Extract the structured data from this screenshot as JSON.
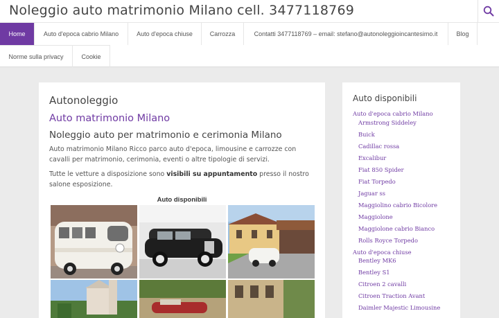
{
  "header": {
    "site_title": "Noleggio auto matrimonio Milano cell. 3477118769",
    "search_icon": "search-icon"
  },
  "nav": {
    "items": [
      {
        "label": "Home",
        "active": true
      },
      {
        "label": "Auto d'epoca cabrio Milano"
      },
      {
        "label": "Auto d'epoca chiuse"
      },
      {
        "label": "Carrozza"
      },
      {
        "label": "Contatti 3477118769 – email: stefano@autonoleggioincantesimo.it"
      },
      {
        "label": "Blog"
      },
      {
        "label": "Norme sulla privacy"
      },
      {
        "label": "Cookie"
      }
    ]
  },
  "main": {
    "page_title": "Autonoleggio",
    "heading": "Auto matrimonio Milano",
    "subheading": "Noleggio auto per matrimonio e cerimonia Milano",
    "paragraph1": "Auto matrimonio Milano Ricco parco auto d'epoca, limousine e carrozze con cavalli per matrimonio, cerimonia, eventi o altre tipologie di servizi.",
    "paragraph2_before": "Tutte le vetture a disposizione sono ",
    "paragraph2_bold": "visibili su appuntamento",
    "paragraph2_after": " presso il nostro salone esposizione.",
    "gallery_caption": "Auto disponibili"
  },
  "sidebar": {
    "title": "Auto disponibili",
    "links": [
      {
        "label": "Auto d'epoca cabrio Milano",
        "level": "category"
      },
      {
        "label": "Armstrong Siddeley",
        "level": "sub"
      },
      {
        "label": "Buick",
        "level": "sub"
      },
      {
        "label": "Cadillac rossa",
        "level": "sub"
      },
      {
        "label": "Excalibur",
        "level": "sub"
      },
      {
        "label": "Fiat 850 Spider",
        "level": "sub"
      },
      {
        "label": "Fiat Torpedo",
        "level": "sub"
      },
      {
        "label": "Jaguar ss",
        "level": "sub"
      },
      {
        "label": "Maggiolino cabrio Bicolore",
        "level": "sub"
      },
      {
        "label": "Maggiolone",
        "level": "sub"
      },
      {
        "label": "Maggiolone cabrio Bianco",
        "level": "sub"
      },
      {
        "label": "Rolls Royce Torpedo",
        "level": "sub"
      },
      {
        "label": "Auto d'epoca chiuse",
        "level": "category"
      },
      {
        "label": "Bentley MK6",
        "level": "sub"
      },
      {
        "label": "Bentley S1",
        "level": "sub"
      },
      {
        "label": "Citroen 2 cavalli",
        "level": "sub"
      },
      {
        "label": "Citroen Traction Avant",
        "level": "sub"
      },
      {
        "label": "Daimler Majestic Limousine",
        "level": "sub"
      }
    ]
  },
  "colors": {
    "accent": "#6f3aa3",
    "background": "#ebebeb",
    "text": "#555555"
  }
}
